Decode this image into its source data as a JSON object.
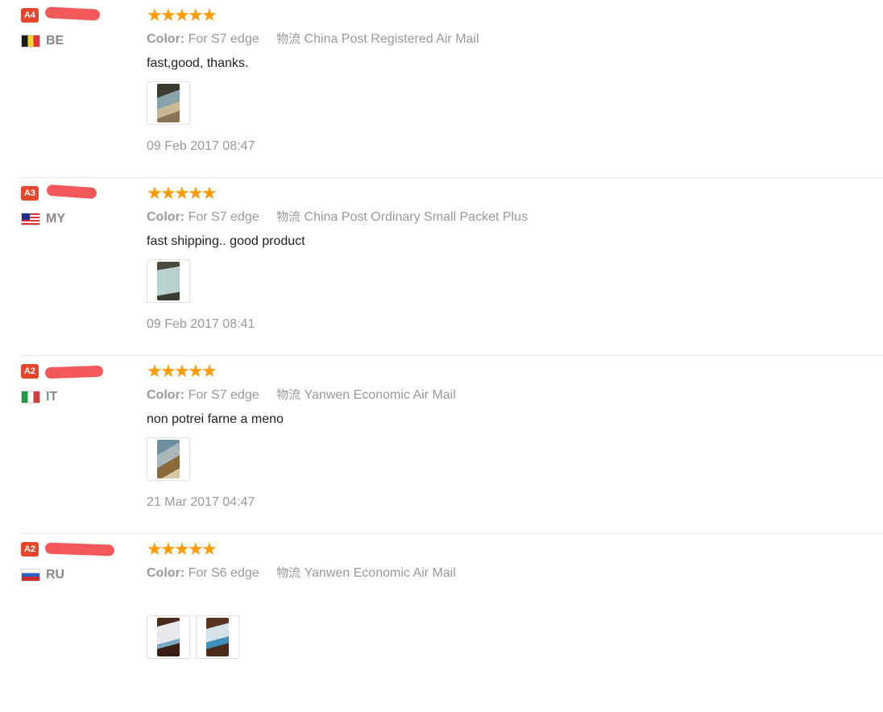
{
  "reviews": [
    {
      "level": "A4",
      "country": "BE",
      "flag_icon": "belgium-flag-icon",
      "stars": 5,
      "color_label": "Color:",
      "color_value": "For S7 edge",
      "logistics_label": "物流",
      "logistics_value": "China Post Registered Air Mail",
      "text": "fast,good, thanks.",
      "photo_count": 1,
      "date": "09 Feb 2017 08:47"
    },
    {
      "level": "A3",
      "country": "MY",
      "flag_icon": "malaysia-flag-icon",
      "stars": 5,
      "color_label": "Color:",
      "color_value": "For S7 edge",
      "logistics_label": "物流",
      "logistics_value": "China Post Ordinary Small Packet Plus",
      "text": "fast shipping.. good product",
      "photo_count": 1,
      "date": "09 Feb 2017 08:41"
    },
    {
      "level": "A2",
      "country": "IT",
      "flag_icon": "italy-flag-icon",
      "stars": 5,
      "color_label": "Color:",
      "color_value": "For S7 edge",
      "logistics_label": "物流",
      "logistics_value": "Yanwen Economic Air Mail",
      "text": "non potrei farne a meno",
      "photo_count": 1,
      "date": "21 Mar 2017 04:47"
    },
    {
      "level": "A2",
      "country": "RU",
      "flag_icon": "russia-flag-icon",
      "stars": 5,
      "color_label": "Color:",
      "color_value": "For S6 edge",
      "logistics_label": "物流",
      "logistics_value": "Yanwen Economic Air Mail",
      "text": "",
      "photo_count": 2,
      "date": ""
    }
  ],
  "colors": {
    "star": "#ff9b00",
    "level_badge": "#e8452c",
    "redaction": "#f25050",
    "meta_text": "#999999",
    "body_text": "#222222"
  }
}
